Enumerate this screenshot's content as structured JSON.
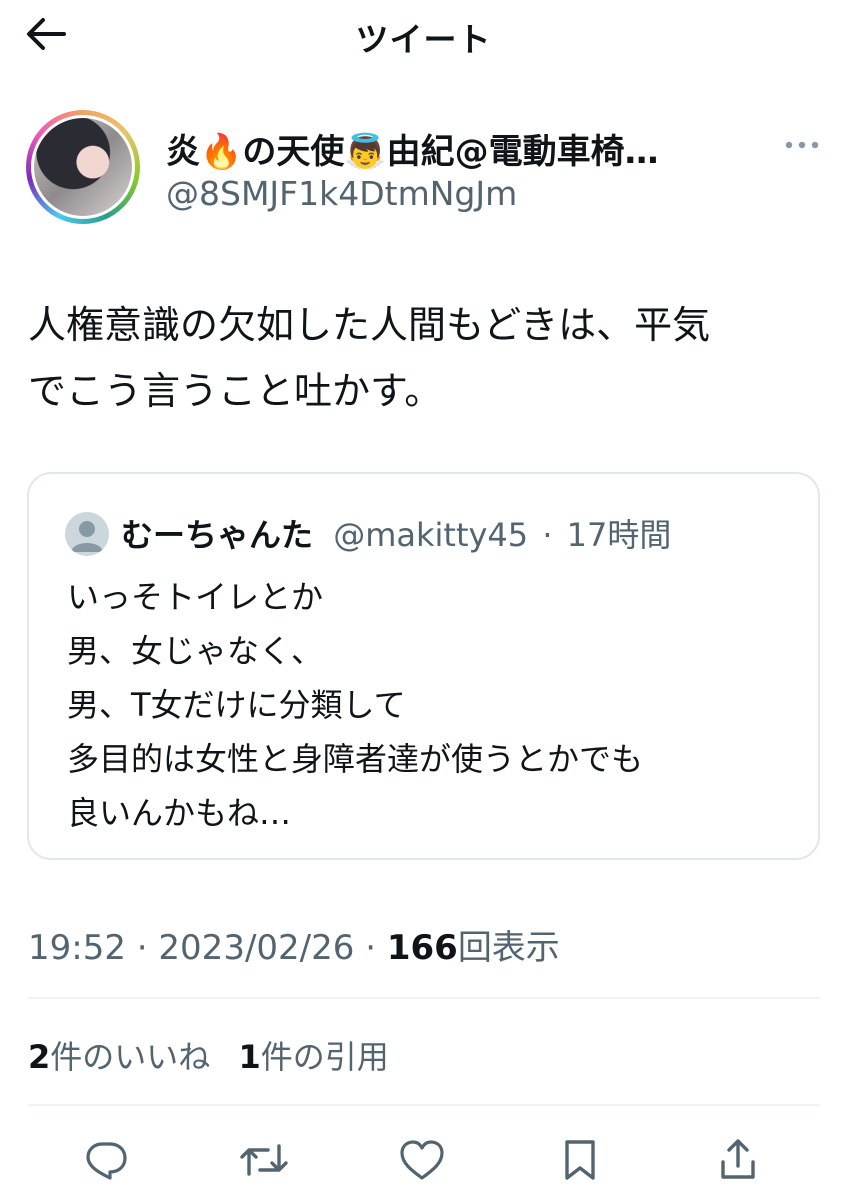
{
  "header": {
    "title": "ツイート"
  },
  "author": {
    "display_name": "炎🔥の天使👼由紀@電動車椅…",
    "handle": "@8SMJF1k4DtmNgJm"
  },
  "tweet": {
    "text": "人権意識の欠如した人間もどきは、平気\nでこう言うこと吐かす。"
  },
  "quote": {
    "name": "むーちゃんた",
    "handle": "@makitty45",
    "separator": "·",
    "time": "17時間",
    "text": "いっそトイレとか\n男、女じゃなく、\n男、T女だけに分類して\n多目的は女性と身障者達が使うとかでも\n良いんかもね…"
  },
  "meta": {
    "time": "19:52",
    "date": "2023/02/26",
    "sep": "·",
    "views_count": "166",
    "views_label": "回表示"
  },
  "stats": {
    "likes_count": "2",
    "likes_label": "件のいいね",
    "quotes_count": "1",
    "quotes_label": "件の引用"
  },
  "icons": {
    "back": "arrow-left-icon",
    "more": "more-dots-icon",
    "reply": "reply-icon",
    "retweet": "retweet-icon",
    "like": "heart-icon",
    "bookmark": "bookmark-icon",
    "share": "share-icon"
  },
  "colors": {
    "text": "#0f1419",
    "secondary": "#536471",
    "icon": "#536471",
    "border": "#e1e8ed"
  }
}
